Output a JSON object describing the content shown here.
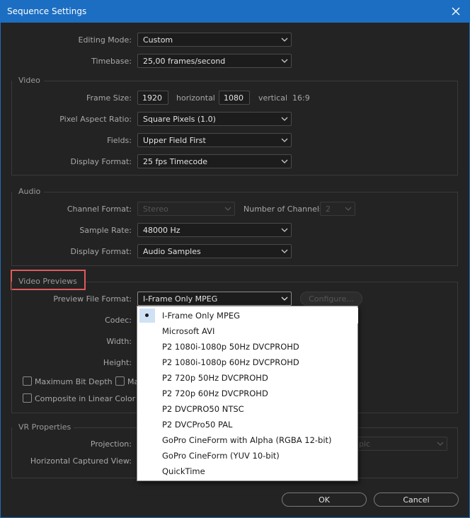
{
  "window": {
    "title": "Sequence Settings"
  },
  "general": {
    "editing_mode_label": "Editing Mode:",
    "editing_mode_value": "Custom",
    "timebase_label": "Timebase:",
    "timebase_value": "25,00  frames/second"
  },
  "video": {
    "section_title": "Video",
    "frame_size_label": "Frame Size:",
    "frame_width": "1920",
    "horizontal_label": "horizontal",
    "frame_height": "1080",
    "vertical_label": "vertical",
    "aspect": "16:9",
    "pixel_aspect_label": "Pixel Aspect Ratio:",
    "pixel_aspect_value": "Square Pixels (1.0)",
    "fields_label": "Fields:",
    "fields_value": "Upper Field First",
    "display_format_label": "Display Format:",
    "display_format_value": "25 fps Timecode"
  },
  "audio": {
    "section_title": "Audio",
    "channel_format_label": "Channel Format:",
    "channel_format_value": "Stereo",
    "num_channels_label": "Number of Channels:",
    "num_channels_value": "2",
    "sample_rate_label": "Sample Rate:",
    "sample_rate_value": "48000 Hz",
    "display_format_label": "Display Format:",
    "display_format_value": "Audio Samples"
  },
  "previews": {
    "section_title": "Video Previews",
    "preview_format_label": "Preview File Format:",
    "preview_format_value": "I-Frame Only MPEG",
    "configure_label": "Configure...",
    "codec_label": "Codec:",
    "width_label": "Width:",
    "height_label": "Height:",
    "max_bit_depth_label": "Maximum Bit Depth",
    "max_render_label": "Ma",
    "composite_label": "Composite in Linear Color (re"
  },
  "vr": {
    "section_title": "VR Properties",
    "projection_label": "Projection:",
    "projection_value_fragment": "pic",
    "captured_view_label": "Horizontal Captured View:"
  },
  "dropdown_menu": {
    "items": [
      "I-Frame Only MPEG",
      "Microsoft AVI",
      "P2 1080i-1080p 50Hz DVCPROHD",
      "P2 1080i-1080p 60Hz DVCPROHD",
      "P2 720p 50Hz DVCPROHD",
      "P2 720p 60Hz DVCPROHD",
      "P2 DVCPRO50 NTSC",
      "P2 DVCPro50 PAL",
      "GoPro CineForm with Alpha (RGBA 12-bit)",
      "GoPro CineForm (YUV 10-bit)",
      "QuickTime"
    ],
    "selected_index": 0
  },
  "footer": {
    "ok_label": "OK",
    "cancel_label": "Cancel"
  },
  "colors": {
    "title_bar": "#1b6ec2",
    "highlight": "#e05a5a",
    "menu_selection": "#cfe1f5"
  }
}
